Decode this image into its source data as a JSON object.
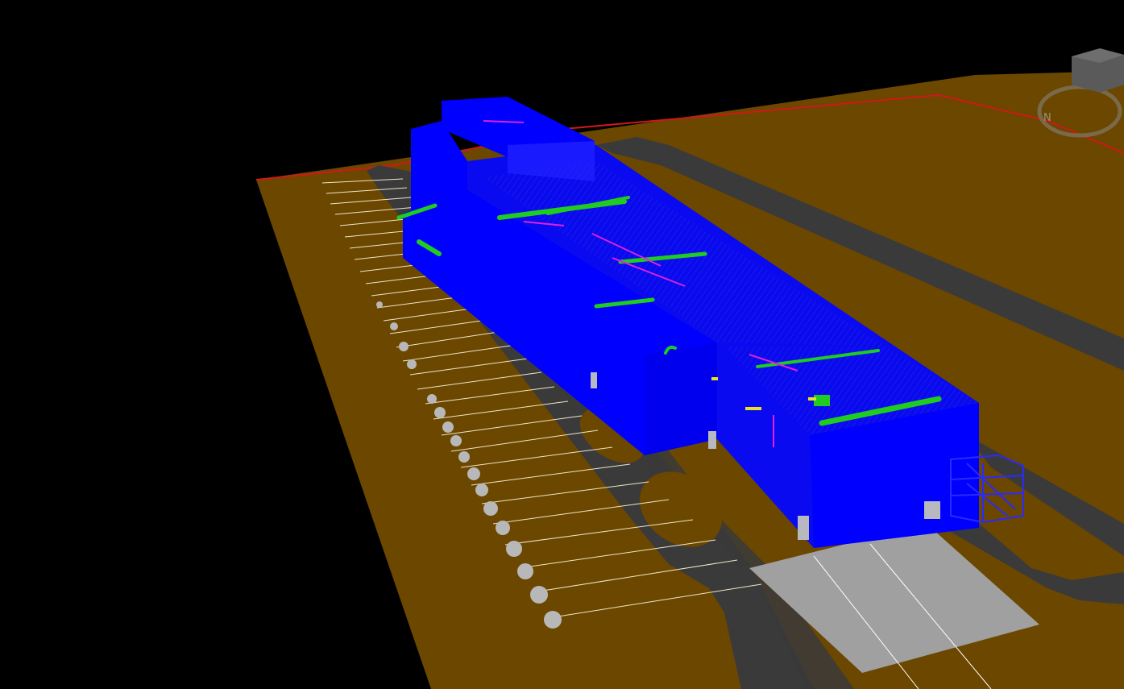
{
  "viewer": {
    "background_color": "#000000",
    "ground_color": "#6b4700",
    "road_color": "#3a3a3a",
    "building_color": "#0000ff",
    "pipe_color": "#1fcc1f",
    "accent_color": "#e020e0",
    "boundary_color": "#d01818",
    "slab_color": "#a0a0a0"
  },
  "navigation_cube": {
    "icon": "view-cube-icon",
    "compass_label": "N"
  }
}
